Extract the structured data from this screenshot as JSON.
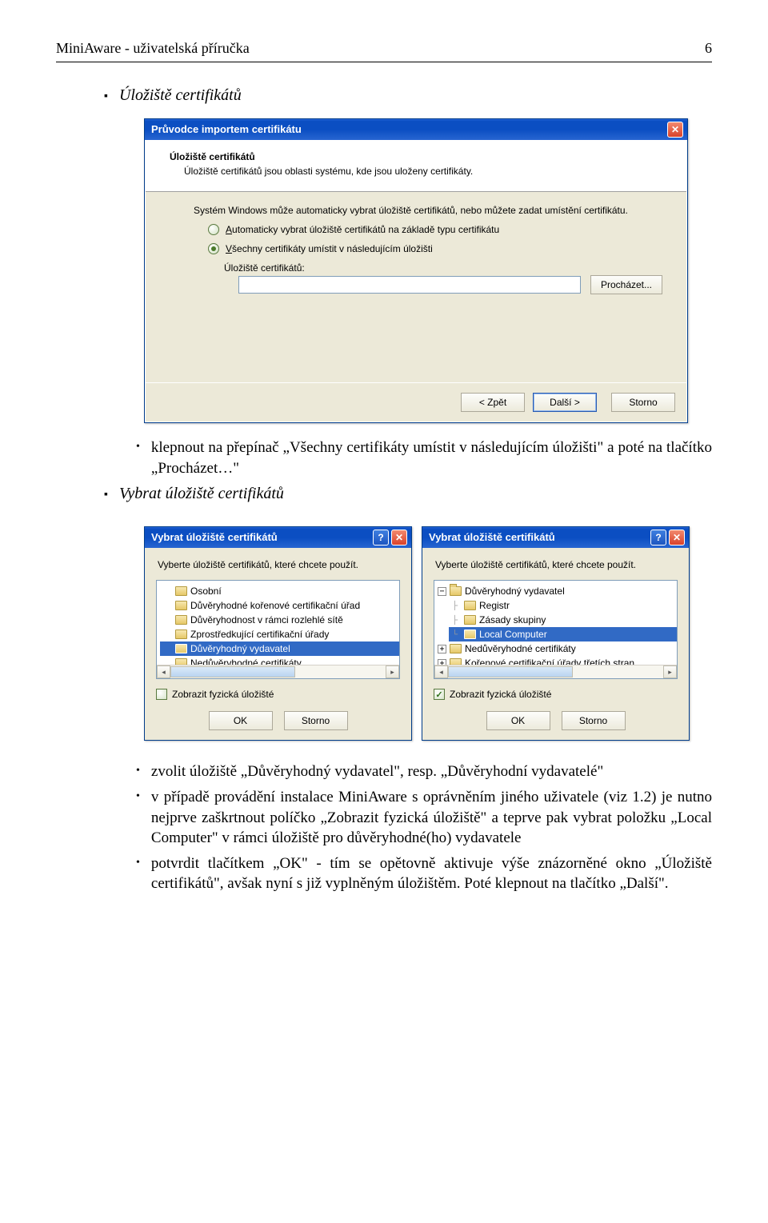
{
  "header": {
    "left": "MiniAware - uživatelská příručka",
    "right": "6"
  },
  "sec1": {
    "title": "Úložiště certifikátů",
    "sub1": "klepnout na přepínač „Všechny certifikáty umístit v následujícím úložišti\" a poté na tlačítko „Procházet…\"",
    "note2_title": "Vybrat úložiště certifikátů",
    "note3a": "zvolit úložiště „Důvěryhodný vydavatel\", resp. „Důvěryhodní vydavatelé\"",
    "note3b": "v případě provádění instalace MiniAware s oprávněním jiného uživatele (viz 1.2) je nutno nejprve zaškrtnout políčko „Zobrazit fyzická úložiště\" a teprve pak vybrat položku „Local Computer\" v rámci úložiště pro důvěryhodné(ho) vydavatele",
    "note3c": "potvrdit tlačítkem „OK\" - tím se opětovně aktivuje výše znázorněné okno „Úložiště certifikátů\", avšak nyní s již vyplněným úložištěm. Poté klepnout na tlačítko „Další\"."
  },
  "wizard": {
    "title": "Průvodce importem certifikátu",
    "panel_h": "Úložiště certifikátů",
    "panel_sub": "Úložiště certifikátů jsou oblasti systému, kde jsou uloženy certifikáty.",
    "desc": "Systém Windows může automaticky vybrat úložiště certifikátů, nebo můžete zadat umístění certifikátu.",
    "radio_auto_pre": "A",
    "radio_auto_rest": "utomaticky vybrat úložiště certifikátů na základě typu certifikátu",
    "radio_all_pre": "V",
    "radio_all_rest": "šechny certifikáty umístit v následujícím úložišti",
    "path_label": "Úložiště certifikátů:",
    "browse": "Procházet...",
    "back": "< Zpět",
    "next": "Další >",
    "cancel": "Storno"
  },
  "picker": {
    "title": "Vybrat úložiště certifikátů",
    "prompt": "Vyberte úložiště certifikátů, které chcete použít.",
    "chk_label": "Zobrazit fyzická úložišté",
    "ok": "OK",
    "cancel": "Storno"
  },
  "picker1_list": {
    "i0": "Osobní",
    "i1": "Důvěryhodné kořenové certifikační úřad",
    "i2": "Důvěryhodnost v rámci rozlehlé sítě",
    "i3": "Zprostředkující certifikační úřady",
    "i4": "Důvěryhodný vydavatel",
    "i5": "Nedůvěrvhodné certifikáty"
  },
  "picker2_list": {
    "i0": "Důvěryhodný vydavatel",
    "i1": "Registr",
    "i2": "Zásady skupiny",
    "i3": "Local Computer",
    "i4": "Nedůvěryhodné certifikáty",
    "i5": "Kořenové certifikační úřady třetích stran"
  }
}
